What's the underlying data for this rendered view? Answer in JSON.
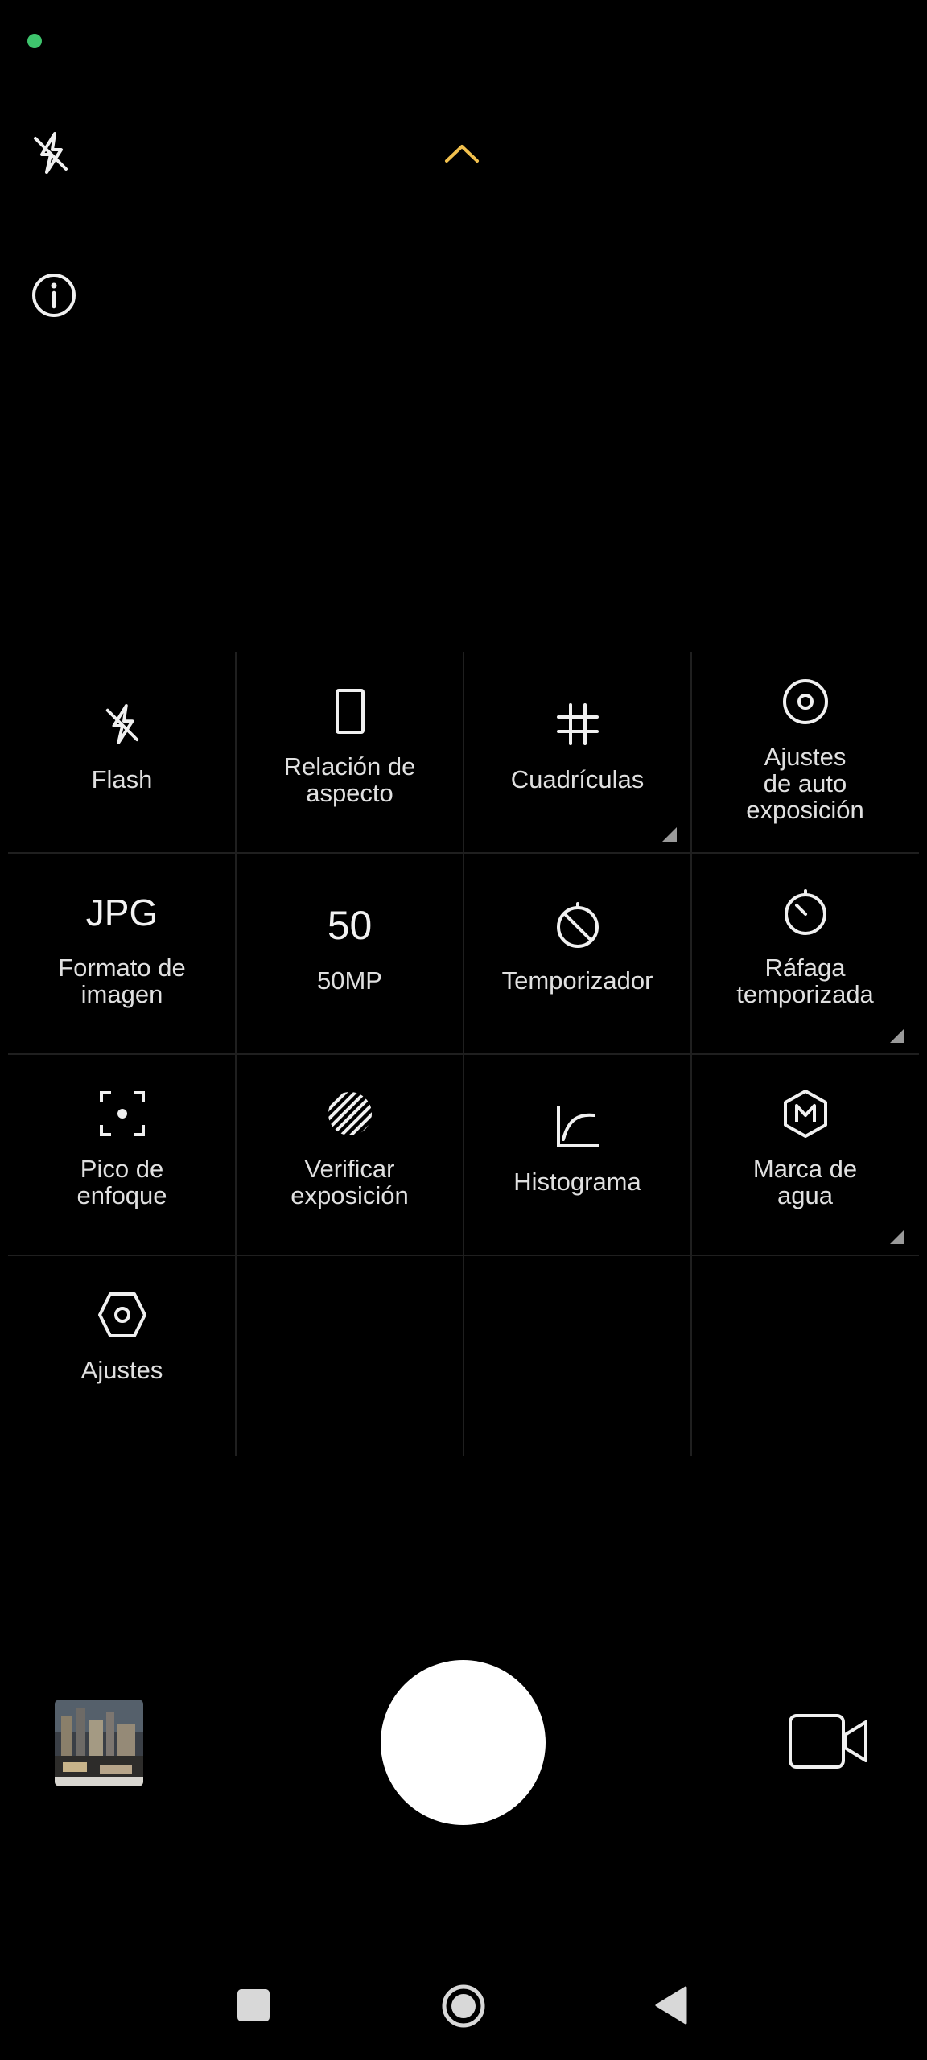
{
  "top_bar": {
    "flash_icon": "flash-off-icon",
    "expand_icon": "chevron-up-icon",
    "info_icon": "info-icon",
    "accent_color": "#f2c04d"
  },
  "settings": {
    "flash": {
      "label": "Flash",
      "icon": "flash-off-icon"
    },
    "aspect_ratio": {
      "label": "Relación de\naspecto",
      "icon": "aspect-ratio-icon"
    },
    "grids": {
      "label": "Cuadrículas",
      "icon": "grid-icon"
    },
    "auto_exposure": {
      "label": "Ajustes\nde auto\nexposición",
      "icon": "exposure-icon"
    },
    "image_format": {
      "value": "JPG",
      "label": "Formato de\nimagen"
    },
    "megapixels": {
      "value": "50",
      "label": "50MP"
    },
    "timer": {
      "label": "Temporizador",
      "icon": "timer-off-icon"
    },
    "timed_burst": {
      "label": "Ráfaga\ntemporizada",
      "icon": "timer-icon"
    },
    "focus_peaking": {
      "label": "Pico de\nenfoque",
      "icon": "focus-peaking-icon"
    },
    "exposure_check": {
      "label": "Verificar\nexposición",
      "icon": "zebra-stripes-icon"
    },
    "histogram": {
      "label": "Histograma",
      "icon": "histogram-icon"
    },
    "watermark": {
      "label": "Marca de\nagua",
      "icon": "watermark-icon"
    },
    "settings": {
      "label": "Ajustes",
      "icon": "settings-hexagon-icon"
    }
  },
  "shutter_row": {
    "gallery_thumbnail": "gallery-thumbnail",
    "shutter": "shutter-button",
    "video_icon": "video-camera-icon"
  },
  "nav_bar": {
    "recents_icon": "square-recents-icon",
    "home_icon": "circle-home-icon",
    "back_icon": "triangle-back-icon"
  }
}
